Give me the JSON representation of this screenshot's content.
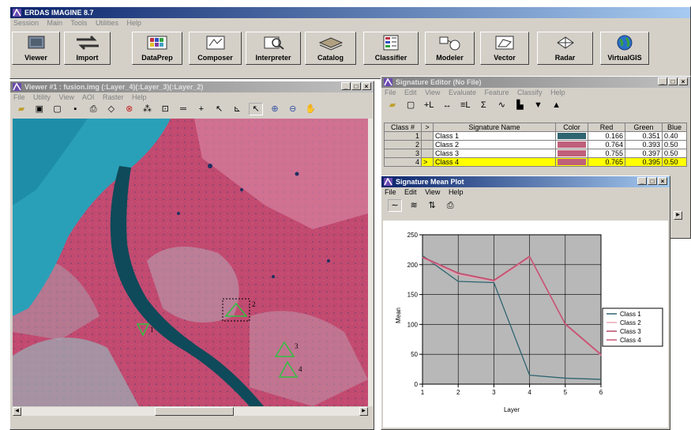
{
  "app": {
    "title": "ERDAS IMAGINE 8.7",
    "menu": [
      "Session",
      "Main",
      "Tools",
      "Utilities",
      "Help"
    ],
    "buttons": [
      {
        "label": "Viewer",
        "icon": "viewer-icon"
      },
      {
        "label": "Import",
        "icon": "import-icon"
      },
      {
        "label": "DataPrep",
        "icon": "dataprep-icon"
      },
      {
        "label": "Composer",
        "icon": "composer-icon"
      },
      {
        "label": "Interpreter",
        "icon": "interpreter-icon"
      },
      {
        "label": "Catalog",
        "icon": "catalog-icon"
      },
      {
        "label": "Classifier",
        "icon": "classifier-icon"
      },
      {
        "label": "Modeler",
        "icon": "modeler-icon"
      },
      {
        "label": "Vector",
        "icon": "vector-icon"
      },
      {
        "label": "Radar",
        "icon": "radar-icon"
      },
      {
        "label": "VirtualGIS",
        "icon": "globe-icon"
      }
    ]
  },
  "viewer": {
    "title": "Viewer #1 : fusion.img (:Layer_4)(:Layer_3)(:Layer_2)",
    "menu": [
      "File",
      "Utility",
      "View",
      "AOI",
      "Raster",
      "Help"
    ],
    "annotations": [
      "1",
      "2",
      "3",
      "4"
    ]
  },
  "sig_editor": {
    "title": "Signature Editor (No File)",
    "menu": [
      "File",
      "Edit",
      "View",
      "Evaluate",
      "Feature",
      "Classify",
      "Help"
    ],
    "columns": [
      "Class #",
      ">",
      "Signature Name",
      "Color",
      "Red",
      "Green",
      "Blue"
    ],
    "rows": [
      {
        "num": "1",
        "mark": "",
        "name": "Class 1",
        "color": "#2e6470",
        "red": "0.166",
        "green": "0.351",
        "blue": "0.40"
      },
      {
        "num": "2",
        "mark": "",
        "name": "Class 2",
        "color": "#c0607a",
        "red": "0.764",
        "green": "0.393",
        "blue": "0.50"
      },
      {
        "num": "3",
        "mark": "",
        "name": "Class 3",
        "color": "#c0607a",
        "red": "0.755",
        "green": "0.397",
        "blue": "0.50"
      },
      {
        "num": "4",
        "mark": ">",
        "name": "Class 4",
        "color": "#c0607a",
        "red": "0.765",
        "green": "0.395",
        "blue": "0.50"
      }
    ]
  },
  "mean_plot": {
    "title": "Signature Mean Plot",
    "menu": [
      "File",
      "Edit",
      "View",
      "Help"
    ],
    "chart_data": {
      "type": "line",
      "xlabel": "Layer",
      "ylabel": "Mean",
      "xlim": [
        1,
        6
      ],
      "ylim": [
        0,
        250
      ],
      "x_ticks": [
        1,
        2,
        3,
        4,
        5,
        6
      ],
      "y_ticks": [
        0,
        50,
        100,
        150,
        200,
        250
      ],
      "grid": true,
      "legend_position": "right",
      "series": [
        {
          "name": "Class 1",
          "color": "#2e6470",
          "values": [
            215,
            172,
            170,
            15,
            10,
            8
          ]
        },
        {
          "name": "Class 2",
          "color": "#e8a8b8",
          "values": [
            212,
            183,
            172,
            212,
            100,
            48
          ]
        },
        {
          "name": "Class 3",
          "color": "#b84a68",
          "values": [
            213,
            186,
            174,
            214,
            101,
            50
          ]
        },
        {
          "name": "Class 4",
          "color": "#c85878",
          "values": [
            212,
            185,
            173,
            213,
            100,
            49
          ]
        }
      ]
    }
  }
}
